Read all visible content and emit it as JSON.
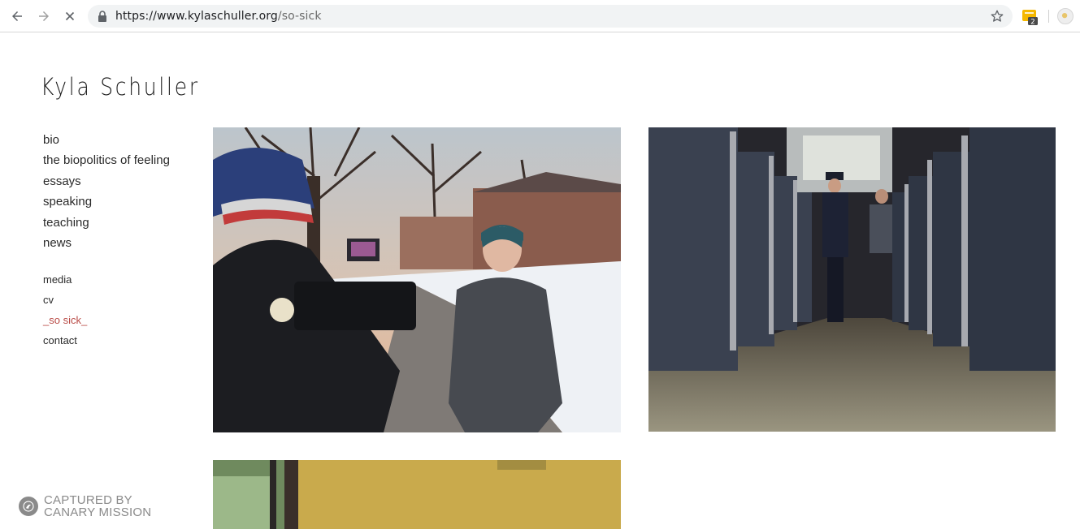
{
  "browser": {
    "url_host": "https://www.kylaschuller.org",
    "url_path": "/so-sick",
    "extension_badge": "2"
  },
  "site": {
    "title": "Kyla Schuller"
  },
  "nav": {
    "main": [
      "bio",
      "the biopolitics of feeling",
      "essays",
      "speaking",
      "teaching",
      "news"
    ],
    "secondary": [
      "media",
      "cv",
      "_so sick_",
      "contact"
    ],
    "active_index": 2,
    "active_color": "#b94b46"
  },
  "watermark": {
    "line1": "CAPTURED BY",
    "line2": "CANARY MISSION"
  }
}
